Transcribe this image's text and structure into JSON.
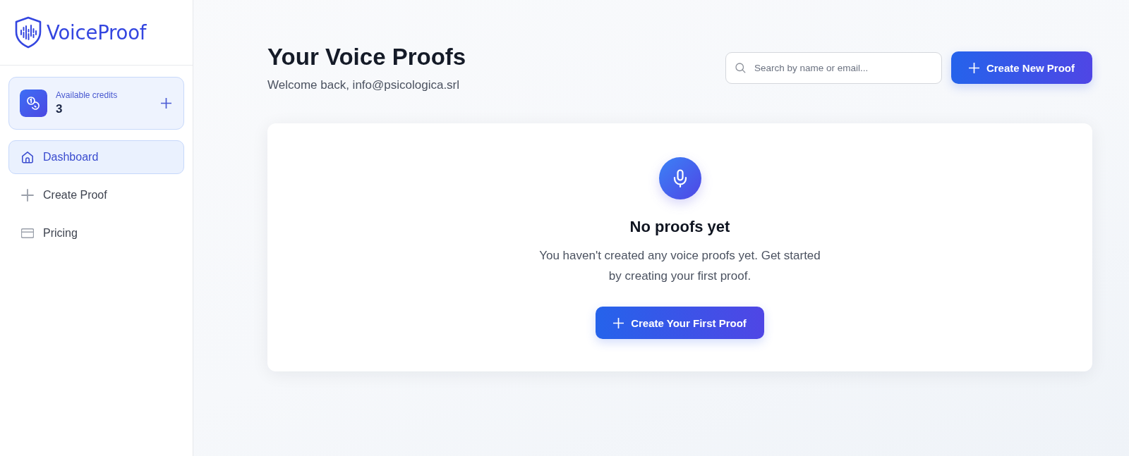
{
  "sidebar": {
    "brand": "VoiceProof",
    "credits": {
      "label": "Available credits",
      "value": "3"
    },
    "items": [
      {
        "label": "Dashboard",
        "selected": true
      },
      {
        "label": "Create Proof",
        "selected": false
      },
      {
        "label": "Pricing",
        "selected": false
      }
    ]
  },
  "header": {
    "title": "Your Voice Proofs",
    "subtitle": "Welcome back, info@psicologica.srl",
    "search": {
      "placeholder": "Search by name or email..."
    },
    "primary_button": {
      "label": "Create New Proof"
    }
  },
  "empty_state": {
    "title": "No proofs yet",
    "message": "You haven't created any voice proofs yet. Get started by creating your first proof.",
    "button": {
      "label": "Create Your First Proof"
    }
  }
}
